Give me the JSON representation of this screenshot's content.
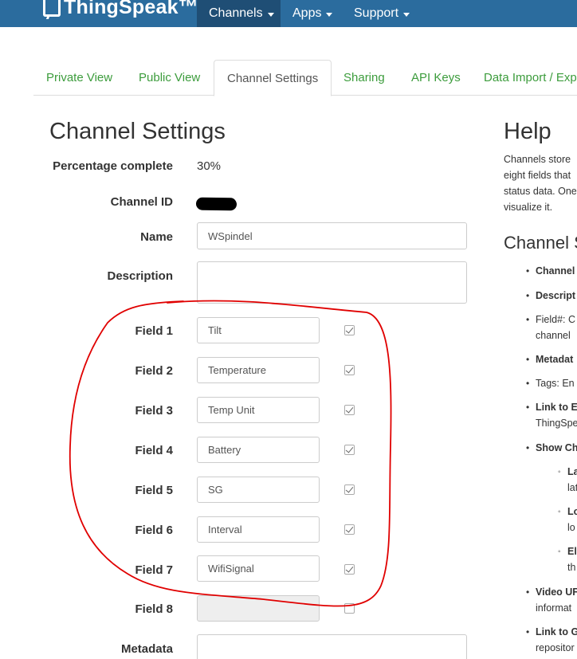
{
  "navbar": {
    "brand": "ThingSpeak™",
    "items": [
      "Channels",
      "Apps",
      "Support"
    ]
  },
  "tabs": [
    "Private View",
    "Public View",
    "Channel Settings",
    "Sharing",
    "API Keys",
    "Data Import / Exp"
  ],
  "page_title": "Channel Settings",
  "settings": {
    "percentage_label": "Percentage complete",
    "percentage_value": "30%",
    "channel_id_label": "Channel ID",
    "name_label": "Name",
    "name_value": "WSpindel",
    "description_label": "Description",
    "description_value": "",
    "metadata_label": "Metadata",
    "fields": [
      {
        "label": "Field 1",
        "value": "Tilt",
        "checked": true
      },
      {
        "label": "Field 2",
        "value": "Temperature",
        "checked": true
      },
      {
        "label": "Field 3",
        "value": "Temp Unit",
        "checked": true
      },
      {
        "label": "Field 4",
        "value": "Battery",
        "checked": true
      },
      {
        "label": "Field 5",
        "value": "SG",
        "checked": true
      },
      {
        "label": "Field 6",
        "value": "Interval",
        "checked": true
      },
      {
        "label": "Field 7",
        "value": "WifiSignal",
        "checked": true
      },
      {
        "label": "Field 8",
        "value": "",
        "checked": false
      }
    ]
  },
  "help": {
    "title": "Help",
    "intro_lines": [
      "Channels store",
      "eight fields that",
      "status data. One",
      "visualize it."
    ],
    "subtitle": "Channel S",
    "items": [
      "Channel",
      "Descript",
      "Field#: C",
      "channel",
      "Metadat",
      "Tags: En",
      "Link to E",
      "ThingSpe",
      "Show Ch",
      "Video UF",
      "informat",
      "Link to G",
      "repositor"
    ],
    "sub_items": [
      "La",
      "lat",
      "Lo",
      "lo",
      "El",
      "th"
    ]
  },
  "colors": {
    "navbar": "#2b6c9e",
    "tab_link": "#3c9c3c",
    "annotation": "#e00000"
  }
}
